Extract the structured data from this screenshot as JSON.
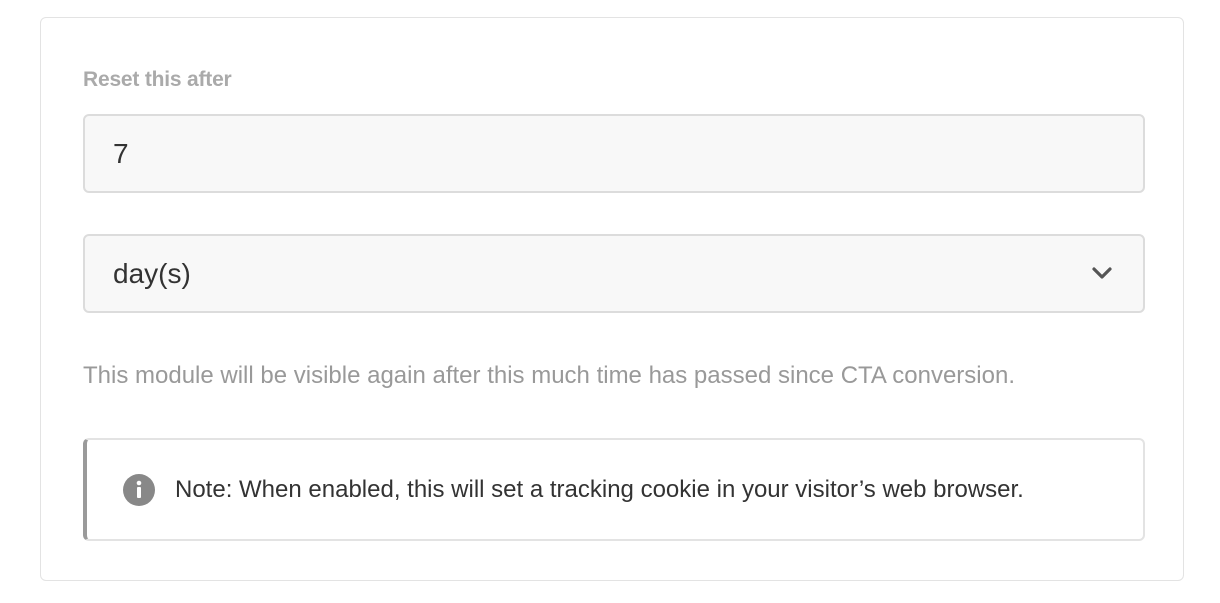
{
  "reset": {
    "label": "Reset this after",
    "amount_value": "7",
    "unit_selected": "day(s)"
  },
  "help_text": "This module will be visible again after this much time has passed since CTA conversion.",
  "note": {
    "text": "Note: When enabled, this will set a tracking cookie in your visitor’s web browser.",
    "icon": "info-icon"
  },
  "colors": {
    "label": "#aaaaaa",
    "input_background": "#f8f8f8",
    "input_border": "#dcdcdc",
    "text": "#333333",
    "muted_text": "#999999",
    "note_accent": "#9a9a9a",
    "info_icon": "#888888"
  }
}
